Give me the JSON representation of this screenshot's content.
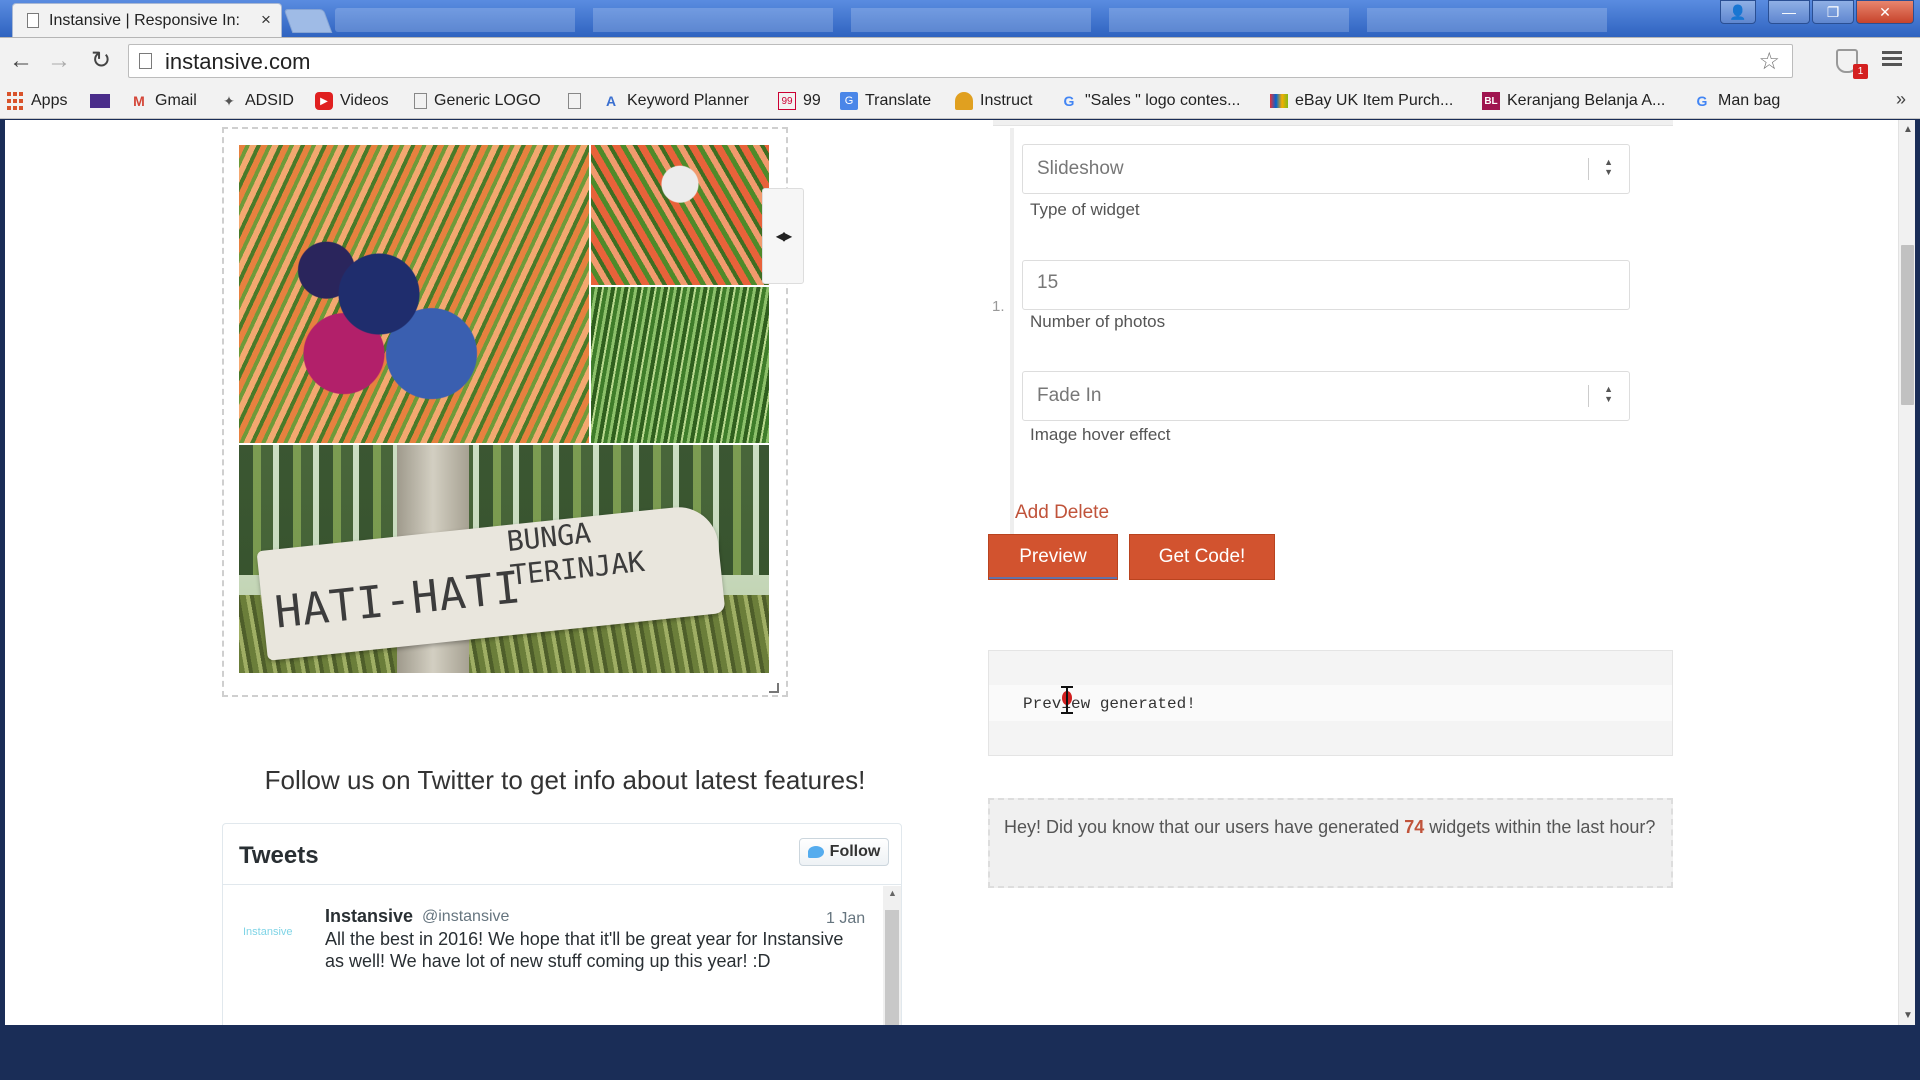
{
  "browser": {
    "tab_title": "Instansive | Responsive In:",
    "tab_close": "×",
    "url": "instansive.com",
    "win_user": "👤",
    "win_minimize": "—",
    "win_maximize": "❐",
    "win_close": "✕",
    "nav_back": "←",
    "nav_forward": "→",
    "nav_reload": "↻",
    "bookmark_star": "☆",
    "extension_badge": "1"
  },
  "bookmarks": [
    {
      "label": "Apps",
      "icon": "apps-grid-icon"
    },
    {
      "label": "",
      "icon": "mail-icon"
    },
    {
      "label": "Gmail",
      "icon": "gmail-icon"
    },
    {
      "label": "ADSID",
      "icon": "adsid-icon"
    },
    {
      "label": "Videos",
      "icon": "youtube-icon"
    },
    {
      "label": "Generic LOGO",
      "icon": "page-icon"
    },
    {
      "label": "",
      "icon": "page-icon"
    },
    {
      "label": "Keyword Planner",
      "icon": "adwords-icon"
    },
    {
      "label": "99",
      "icon": "99-icon"
    },
    {
      "label": "Translate",
      "icon": "translate-icon"
    },
    {
      "label": "Instruct",
      "icon": "instruct-icon"
    },
    {
      "label": "\"Sales \" logo contes...",
      "icon": "google-icon"
    },
    {
      "label": "eBay UK Item Purch...",
      "icon": "ebay-icon"
    },
    {
      "label": "Keranjang Belanja A...",
      "icon": "bl-icon"
    },
    {
      "label": "Man bag",
      "icon": "google-icon"
    }
  ],
  "bookmarks_more": "»",
  "preview": {
    "sign_line1": "HATI-HATI",
    "sign_line2": "BUNGA\nTERINJAK",
    "slider_handle": "◀▶"
  },
  "twitter": {
    "heading": "Follow us on Twitter to get info about latest features!",
    "widget_title": "Tweets",
    "follow_label": "Follow",
    "tweet": {
      "logo_text": "Instansive",
      "name": "Instansive",
      "handle": "@instansive",
      "date": "1 Jan",
      "text": "All the best in 2016! We hope that it'll be great year for Instansive as well! We have lot of new stuff coming up  this year! :D"
    }
  },
  "form": {
    "row_index": "1.",
    "widget_type": {
      "value": "Slideshow",
      "label": "Type of widget"
    },
    "photo_count": {
      "value": "15",
      "label": "Number of photos"
    },
    "hover_effect": {
      "value": "Fade In",
      "label": "Image hover effect"
    },
    "add_delete": "Add Delete",
    "preview_button": "Preview",
    "getcode_button": "Get Code!",
    "output_text": "Preview generated!",
    "stats_prefix": "Hey! Did you know that our users have generated ",
    "stats_count": "74",
    "stats_suffix": " widgets within the last hour?"
  },
  "colors": {
    "accent": "#d2532f",
    "link": "#c0533a",
    "footer": "#1a2d57",
    "titlebar": "#3a6fc9"
  }
}
